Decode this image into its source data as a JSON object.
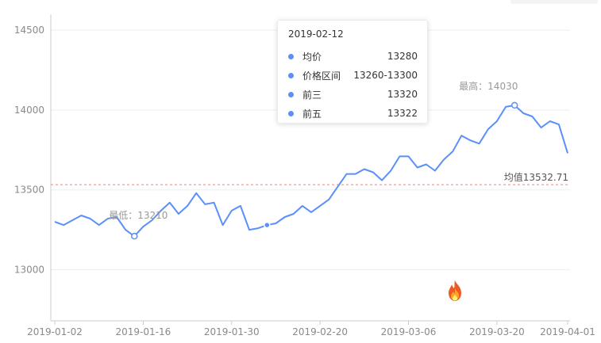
{
  "chart_data": {
    "type": "line",
    "series": [
      {
        "x": [
          "2019-01-02",
          "2019-01-03",
          "2019-01-04",
          "2019-01-07",
          "2019-01-08",
          "2019-01-09",
          "2019-01-10",
          "2019-01-11",
          "2019-01-14",
          "2019-01-15",
          "2019-01-16",
          "2019-01-17",
          "2019-01-18",
          "2019-01-21",
          "2019-01-22",
          "2019-01-23",
          "2019-01-24",
          "2019-01-25",
          "2019-01-28",
          "2019-01-29",
          "2019-01-30",
          "2019-01-31",
          "2019-02-01",
          "2019-02-11",
          "2019-02-12",
          "2019-02-13",
          "2019-02-14",
          "2019-02-15",
          "2019-02-18",
          "2019-02-19",
          "2019-02-20",
          "2019-02-21",
          "2019-02-22",
          "2019-02-25",
          "2019-02-26",
          "2019-02-27",
          "2019-02-28",
          "2019-03-01",
          "2019-03-04",
          "2019-03-05",
          "2019-03-06",
          "2019-03-07",
          "2019-03-08",
          "2019-03-11",
          "2019-03-12",
          "2019-03-13",
          "2019-03-14",
          "2019-03-15",
          "2019-03-18",
          "2019-03-19",
          "2019-03-20",
          "2019-03-21",
          "2019-03-22",
          "2019-03-25",
          "2019-03-26",
          "2019-03-27",
          "2019-03-28",
          "2019-03-29",
          "2019-04-01"
        ],
        "values": [
          13300,
          13280,
          13310,
          13340,
          13320,
          13280,
          13320,
          13330,
          13250,
          13210,
          13270,
          13310,
          13370,
          13420,
          13350,
          13400,
          13480,
          13410,
          13420,
          13280,
          13370,
          13400,
          13250,
          13260,
          13280,
          13290,
          13330,
          13350,
          13400,
          13360,
          13400,
          13440,
          13520,
          13600,
          13600,
          13630,
          13610,
          13560,
          13620,
          13710,
          13710,
          13640,
          13660,
          13620,
          13690,
          13740,
          13840,
          13810,
          13790,
          13880,
          13930,
          14020,
          14030,
          13980,
          13960,
          13890,
          13930,
          13910,
          13730
        ]
      }
    ],
    "xticks": [
      "2019-01-02",
      "2019-01-16",
      "2019-01-30",
      "2019-02-20",
      "2019-03-06",
      "2019-03-20",
      "2019-04-01"
    ],
    "yticks": [
      13000,
      13500,
      14000,
      14500
    ],
    "ylim": [
      12680,
      14600
    ],
    "min_label": "最低：13210",
    "max_label": "最高：14030",
    "mean_label": "均值13532.71",
    "mean_value": 13532.71,
    "line_color": "#5b8ff9",
    "mean_color": "#f08080",
    "grid": true
  },
  "tooltip": {
    "date": "2019-02-12",
    "rows": [
      {
        "name": "均价",
        "value": "13280"
      },
      {
        "name": "价格区间",
        "value": "13260-13300"
      },
      {
        "name": "前三",
        "value": "13320"
      },
      {
        "name": "前五",
        "value": "13322"
      }
    ]
  },
  "decorations": {
    "fire_icon": "fire-emoji"
  }
}
